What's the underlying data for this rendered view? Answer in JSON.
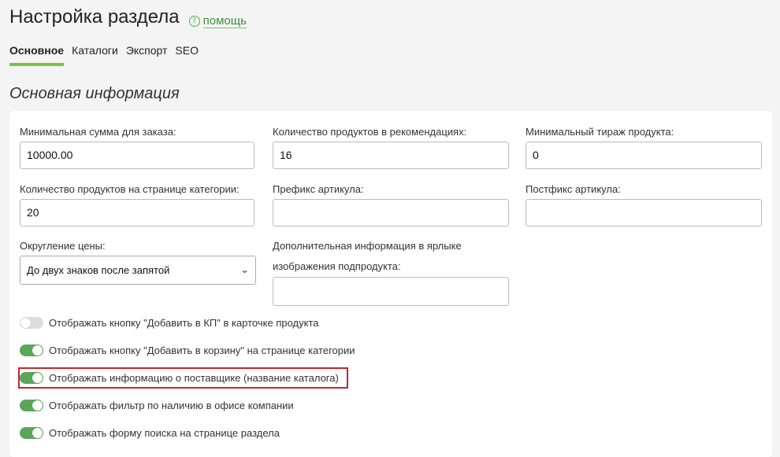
{
  "header": {
    "title": "Настройка раздела",
    "help_icon": "?",
    "help_label": "помощь"
  },
  "tabs": [
    {
      "label": "Основное",
      "active": true
    },
    {
      "label": "Каталоги",
      "active": false
    },
    {
      "label": "Экспорт",
      "active": false
    },
    {
      "label": "SEO",
      "active": false
    }
  ],
  "section": {
    "title": "Основная информация"
  },
  "fields": {
    "min_order_sum": {
      "label": "Минимальная сумма для заказа:",
      "value": "10000.00"
    },
    "recommend_count": {
      "label": "Количество продуктов в рекомендациях:",
      "value": "16"
    },
    "min_print_run": {
      "label": "Минимальный тираж продукта:",
      "value": "0"
    },
    "products_per_page": {
      "label": "Количество продуктов на странице категории:",
      "value": "20"
    },
    "article_prefix": {
      "label": "Префикс артикула:",
      "value": ""
    },
    "article_postfix": {
      "label": "Постфикс артикула:",
      "value": ""
    },
    "price_rounding": {
      "label": "Округление цены:",
      "value": "До двух знаков после запятой"
    },
    "subproduct_info": {
      "label_line1": "Дополнительная информация в ярлыке",
      "label_line2": "изображения подпродукта:",
      "value": ""
    }
  },
  "toggles": [
    {
      "label": "Отображать кнопку \"Добавить в КП\" в карточке продукта",
      "on": false
    },
    {
      "label": "Отображать кнопку \"Добавить в корзину\" на странице категории",
      "on": true
    },
    {
      "label": "Отображать информацию о поставщике (название каталога)",
      "on": true
    },
    {
      "label": "Отображать фильтр по наличию в офисе компании",
      "on": true
    },
    {
      "label": "Отображать форму поиска на странице раздела",
      "on": true
    }
  ],
  "colors": {
    "accent_green": "#7cc242",
    "toggle_on": "#5aa55a",
    "highlight_red": "#c0282d"
  }
}
